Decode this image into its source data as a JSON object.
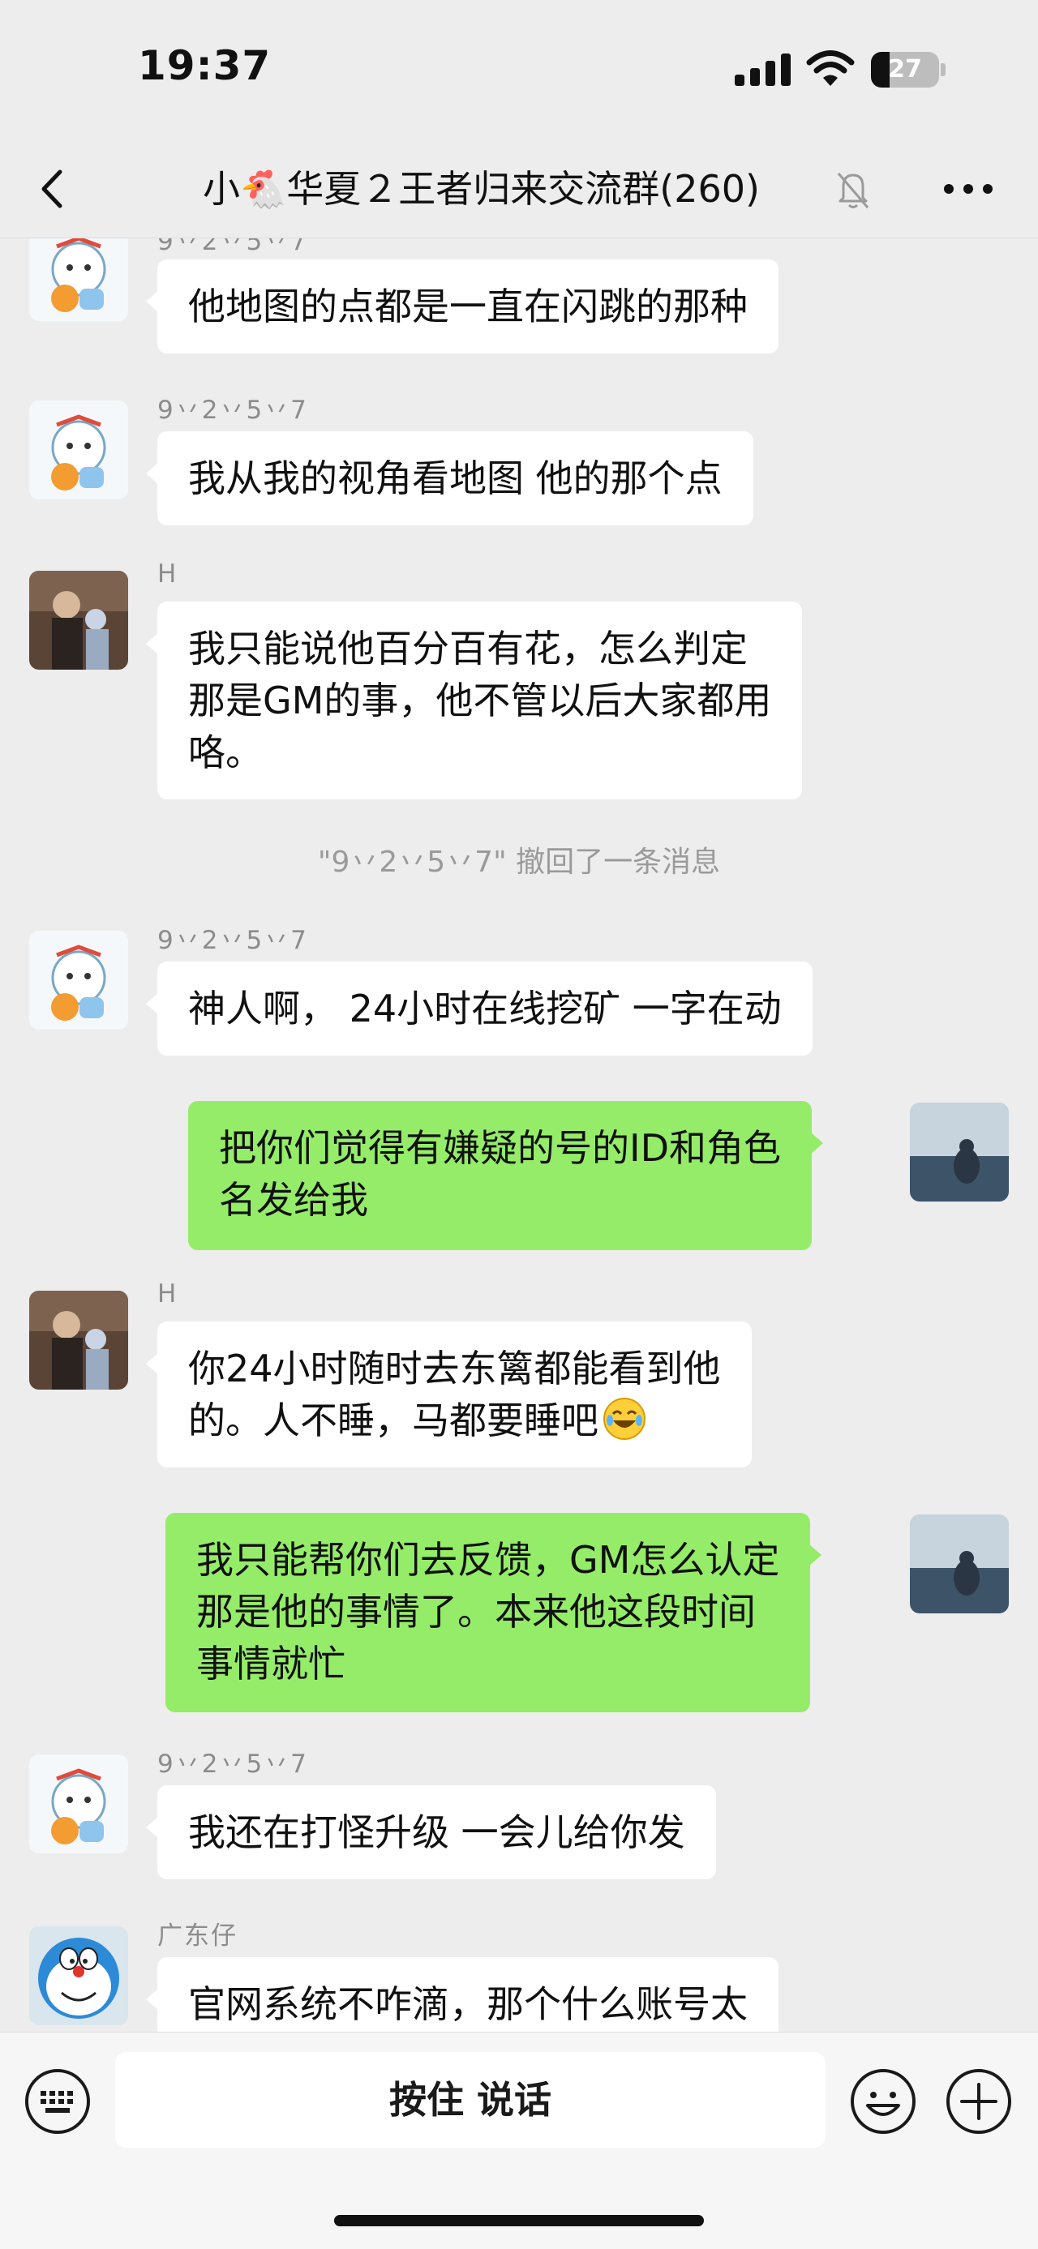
{
  "status_bar": {
    "time": "19:37",
    "battery": "27",
    "battery_level": 0.27
  },
  "nav": {
    "back_icon": "chevron-left-icon",
    "title": "小🐔华夏２王者归来交流群(260)",
    "mute_icon": "bell-slash-icon",
    "more_icon": "ellipsis-icon"
  },
  "messages": {
    "m1": {
      "sender": "9丷2丷5丷7",
      "lines": [
        "他地图的点都是一直在闪跳的那种"
      ]
    },
    "m2": {
      "sender": "9丷2丷5丷7",
      "lines": [
        "我从我的视角看地图 他的那个点"
      ]
    },
    "m3": {
      "sender": "H",
      "lines": [
        "我只能说他百分百有花，怎么判定",
        "那是GM的事，他不管以后大家都用",
        "咯。"
      ]
    },
    "recall": "\"9丷2丷5丷7\" 撤回了一条消息",
    "m4": {
      "sender": "9丷2丷5丷7",
      "lines": [
        "神人啊， 24小时在线挖矿 一字在动"
      ]
    },
    "m5": {
      "lines": [
        "把你们觉得有嫌疑的号的ID和角色",
        "名发给我"
      ]
    },
    "m6": {
      "sender": "H",
      "lines": [
        "你24小时随时去东篱都能看到他",
        "的。人不睡，马都要睡吧"
      ]
    },
    "m7": {
      "lines": [
        "我只能帮你们去反馈，GM怎么认定",
        "那是他的事情了。本来他这段时间",
        "事情就忙"
      ]
    },
    "m8": {
      "sender": "9丷2丷5丷7",
      "lines": [
        "我还在打怪升级 一会儿给你发"
      ]
    },
    "m9": {
      "sender": "广东仔",
      "lines": [
        "官网系统不咋滴，那个什么账号太"
      ]
    }
  },
  "input_bar": {
    "voice_label": "按住 说话",
    "keyboard_icon": "keyboard-icon",
    "emoji_icon": "emoji-icon",
    "plus_icon": "plus-icon"
  },
  "colors": {
    "background": "#ededed",
    "incoming_bubble": "#ffffff",
    "outgoing_bubble": "#95ec69",
    "sender_text": "#8c8c8c"
  }
}
